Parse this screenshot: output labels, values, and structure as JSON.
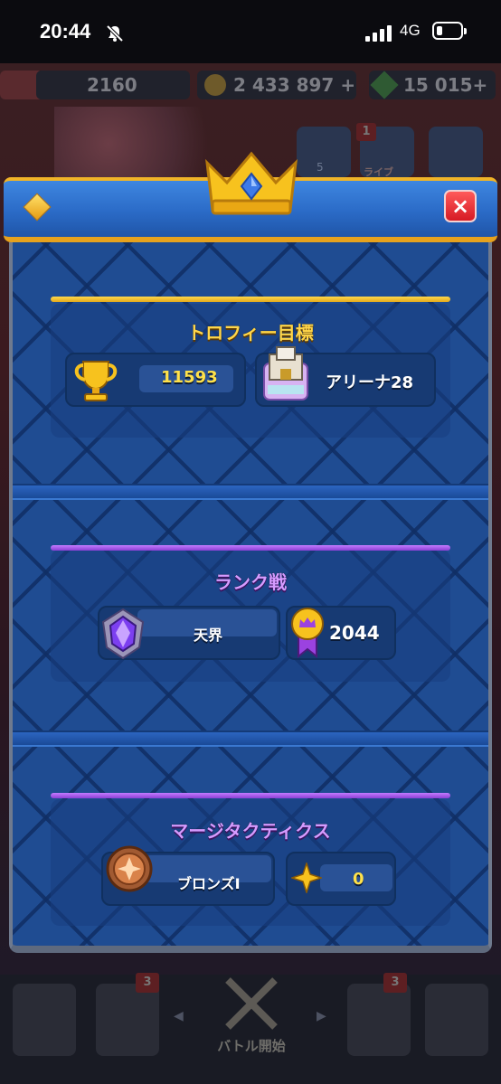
{
  "status_bar": {
    "time": "20:44",
    "network": "4G"
  },
  "background_hud": {
    "trophies": "2160",
    "gold": "2 433 897",
    "gems": "15 015",
    "plus": "+",
    "friends_count": "5",
    "live_label": "ライブ",
    "live_badge": "1",
    "nav_cards_badge": "3",
    "nav_clan_badge": "3",
    "battle_label": "バトル開始"
  },
  "modal": {
    "close_icon": "×",
    "sections": [
      {
        "title": "トロフィー目標",
        "accent": "#f2c12e",
        "left_value": "11593",
        "right_value": "アリーナ28",
        "left_icon": "trophy-icon",
        "right_icon": "arena-icon"
      },
      {
        "title": "ランク戦",
        "accent": "#a855f7",
        "left_value": "天界",
        "right_value": "2044",
        "left_icon": "rank-crystal-icon",
        "right_icon": "medal-icon"
      },
      {
        "title": "マージタクティクス",
        "accent": "#a855f7",
        "left_value": "ブロンズI",
        "right_value": "0",
        "left_icon": "bronze-rank-icon",
        "right_icon": "star-icon"
      }
    ]
  }
}
